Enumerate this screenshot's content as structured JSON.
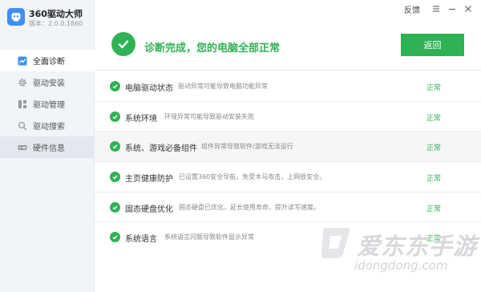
{
  "app": {
    "title": "360驱动大师",
    "version": "版本：2.0.0.1860"
  },
  "nav": [
    {
      "label": "全面诊断",
      "icon": "chart-icon"
    },
    {
      "label": "驱动安装",
      "icon": "gear-icon"
    },
    {
      "label": "驱动管理",
      "icon": "grid-icon"
    },
    {
      "label": "驱动搜索",
      "icon": "search-icon"
    },
    {
      "label": "硬件信息",
      "icon": "hardware-icon"
    }
  ],
  "titlebar": {
    "feedback": "反馈"
  },
  "banner": {
    "message": "诊断完成，您的电脑全部正常",
    "return_label": "返回"
  },
  "items": [
    {
      "title": "电脑驱动状态",
      "desc": "驱动异常可能导致电脑功能异常",
      "status": "正常"
    },
    {
      "title": "系统环境",
      "desc": "环境异常可能导致驱动安装失败",
      "status": "正常"
    },
    {
      "title": "系统、游戏必备组件",
      "desc": "组件异常导致软件/游戏无法运行",
      "status": "正常"
    },
    {
      "title": "主页健康防护",
      "desc": "已设置360安全导航，免受木马攻击，上网很安全。",
      "status": "正常"
    },
    {
      "title": "固态硬盘优化",
      "desc": "固态硬盘已优化，延长使用寿命，提升读写速度。",
      "status": "正常"
    },
    {
      "title": "系统语言",
      "desc": "系统语言问题导致软件显示异常",
      "status": "正常"
    }
  ],
  "watermark": {
    "title": "爱东东手游",
    "url": "idongdong.com"
  },
  "colors": {
    "accent_green": "#2fb253",
    "brand_blue": "#3e8ef7",
    "sidebar_bg": "#f1f4f8"
  }
}
